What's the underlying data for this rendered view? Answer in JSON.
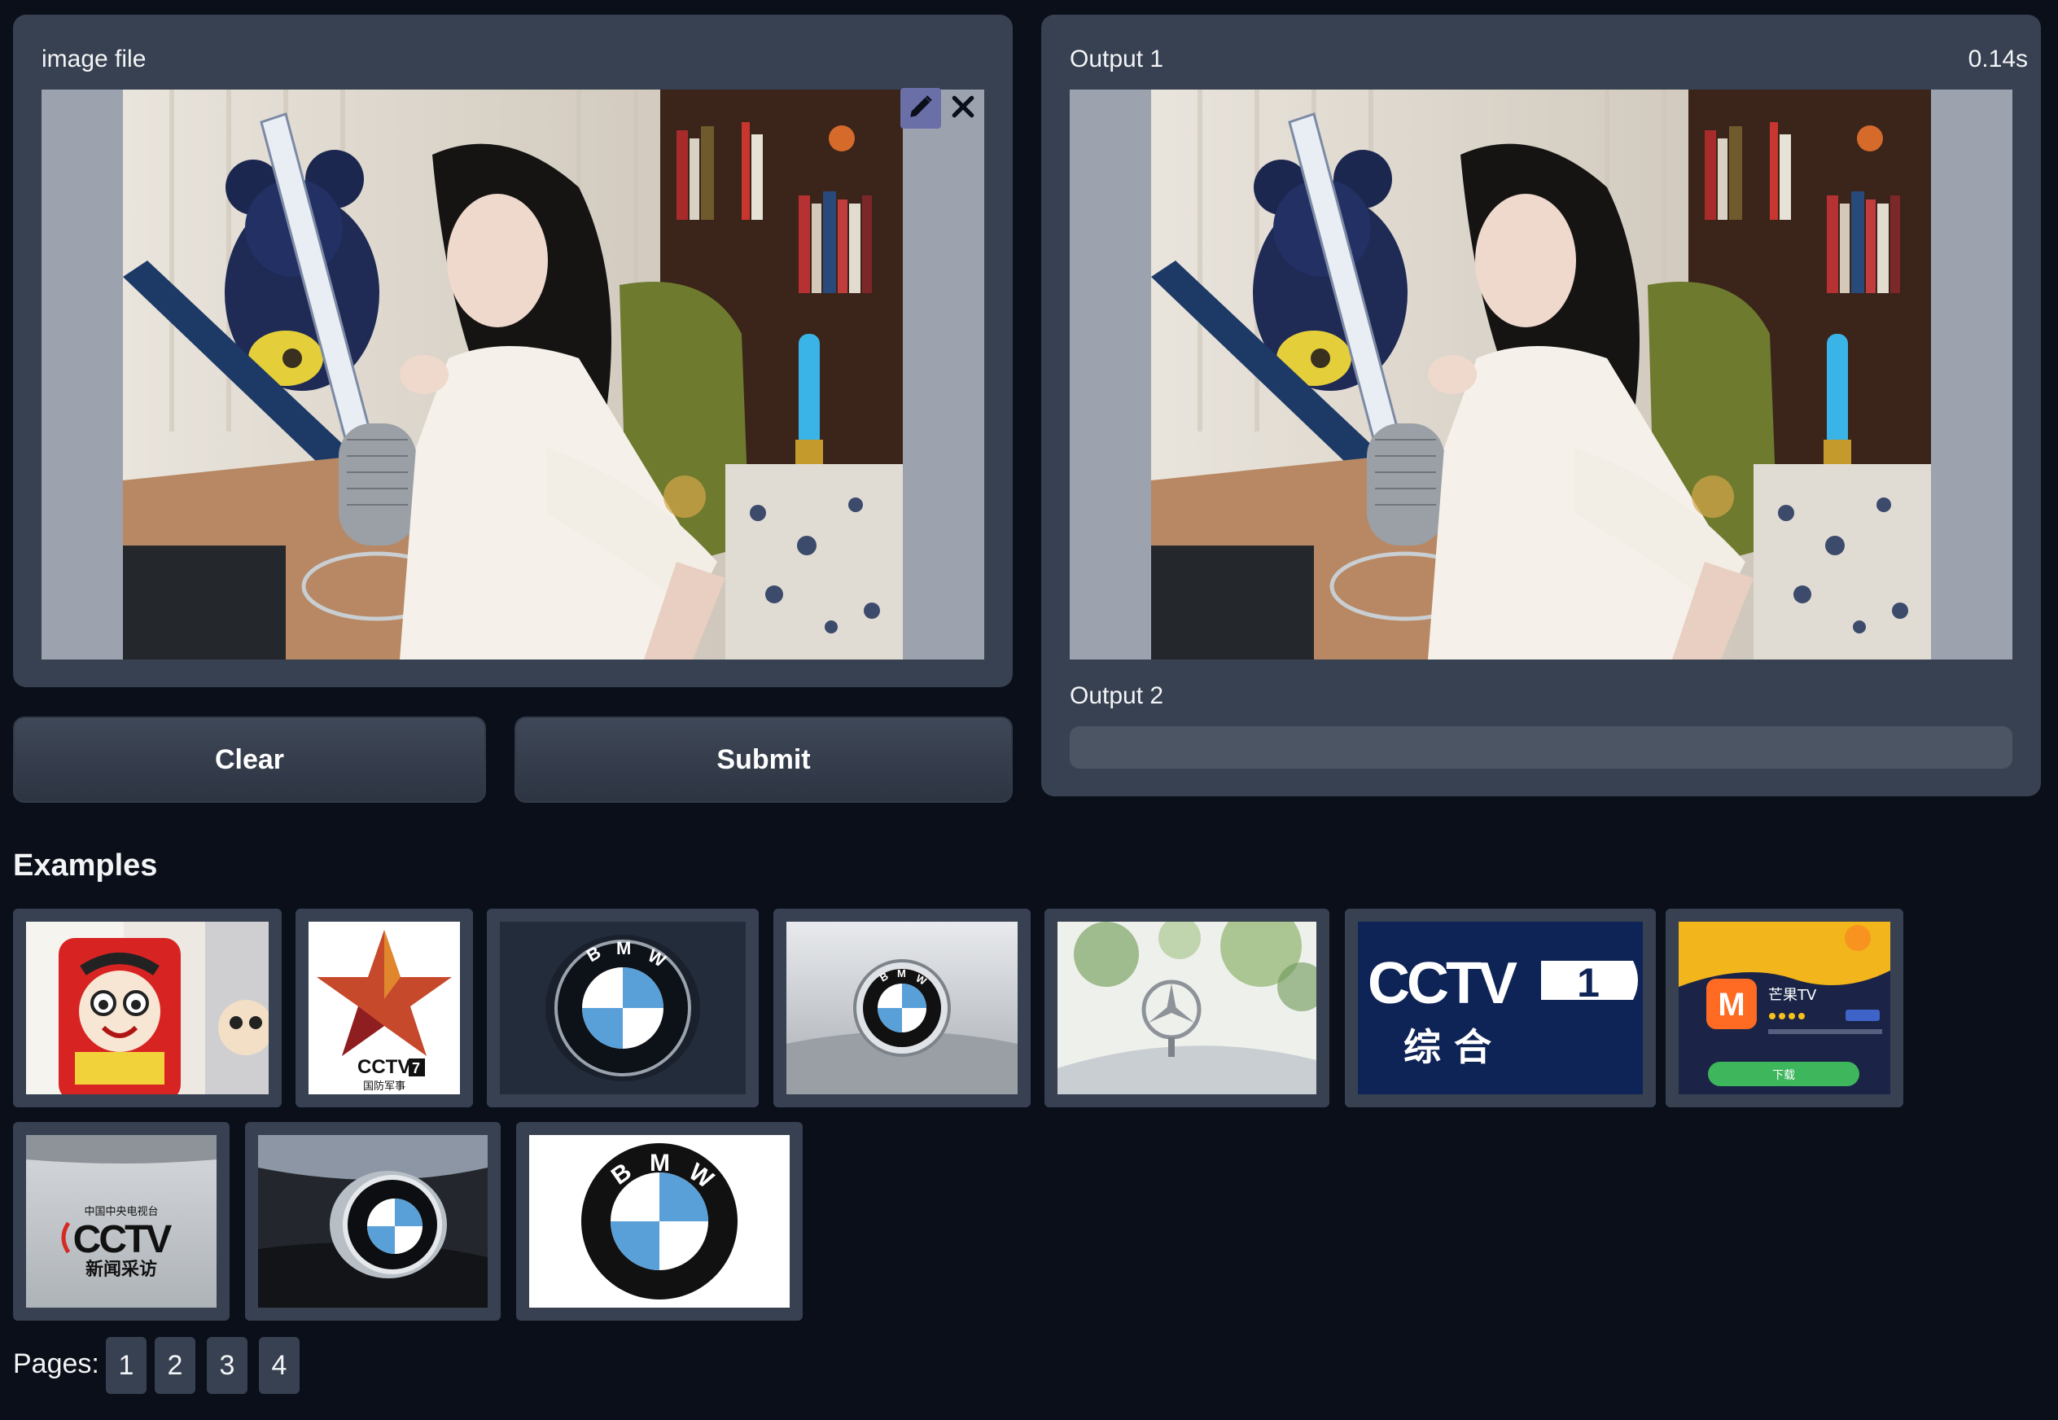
{
  "input_panel": {
    "label": "image file",
    "edit_icon": "pencil-icon",
    "clear_icon": "close-icon"
  },
  "buttons": {
    "clear_label": "Clear",
    "submit_label": "Submit"
  },
  "output_panel": {
    "output1_label": "Output 1",
    "timing": "0.14s",
    "output2_label": "Output 2",
    "output2_value": ""
  },
  "examples": {
    "heading": "Examples",
    "cctv1_text": "综 合",
    "cctv_news_top": "中国中央电视台",
    "cctv_news_bottom": "新闻采访",
    "cctv7_sub": "国防军事",
    "mango_name": "芒果TV",
    "mango_btn": "下载",
    "bmw_letters": "BMW"
  },
  "pagination": {
    "label": "Pages:",
    "pages": [
      "1",
      "2",
      "3",
      "4"
    ]
  },
  "colors": {
    "background": "#0b0f19",
    "panel": "#374151",
    "image_bg": "#9ca3af",
    "bmw_blue": "#5aa0d8"
  }
}
